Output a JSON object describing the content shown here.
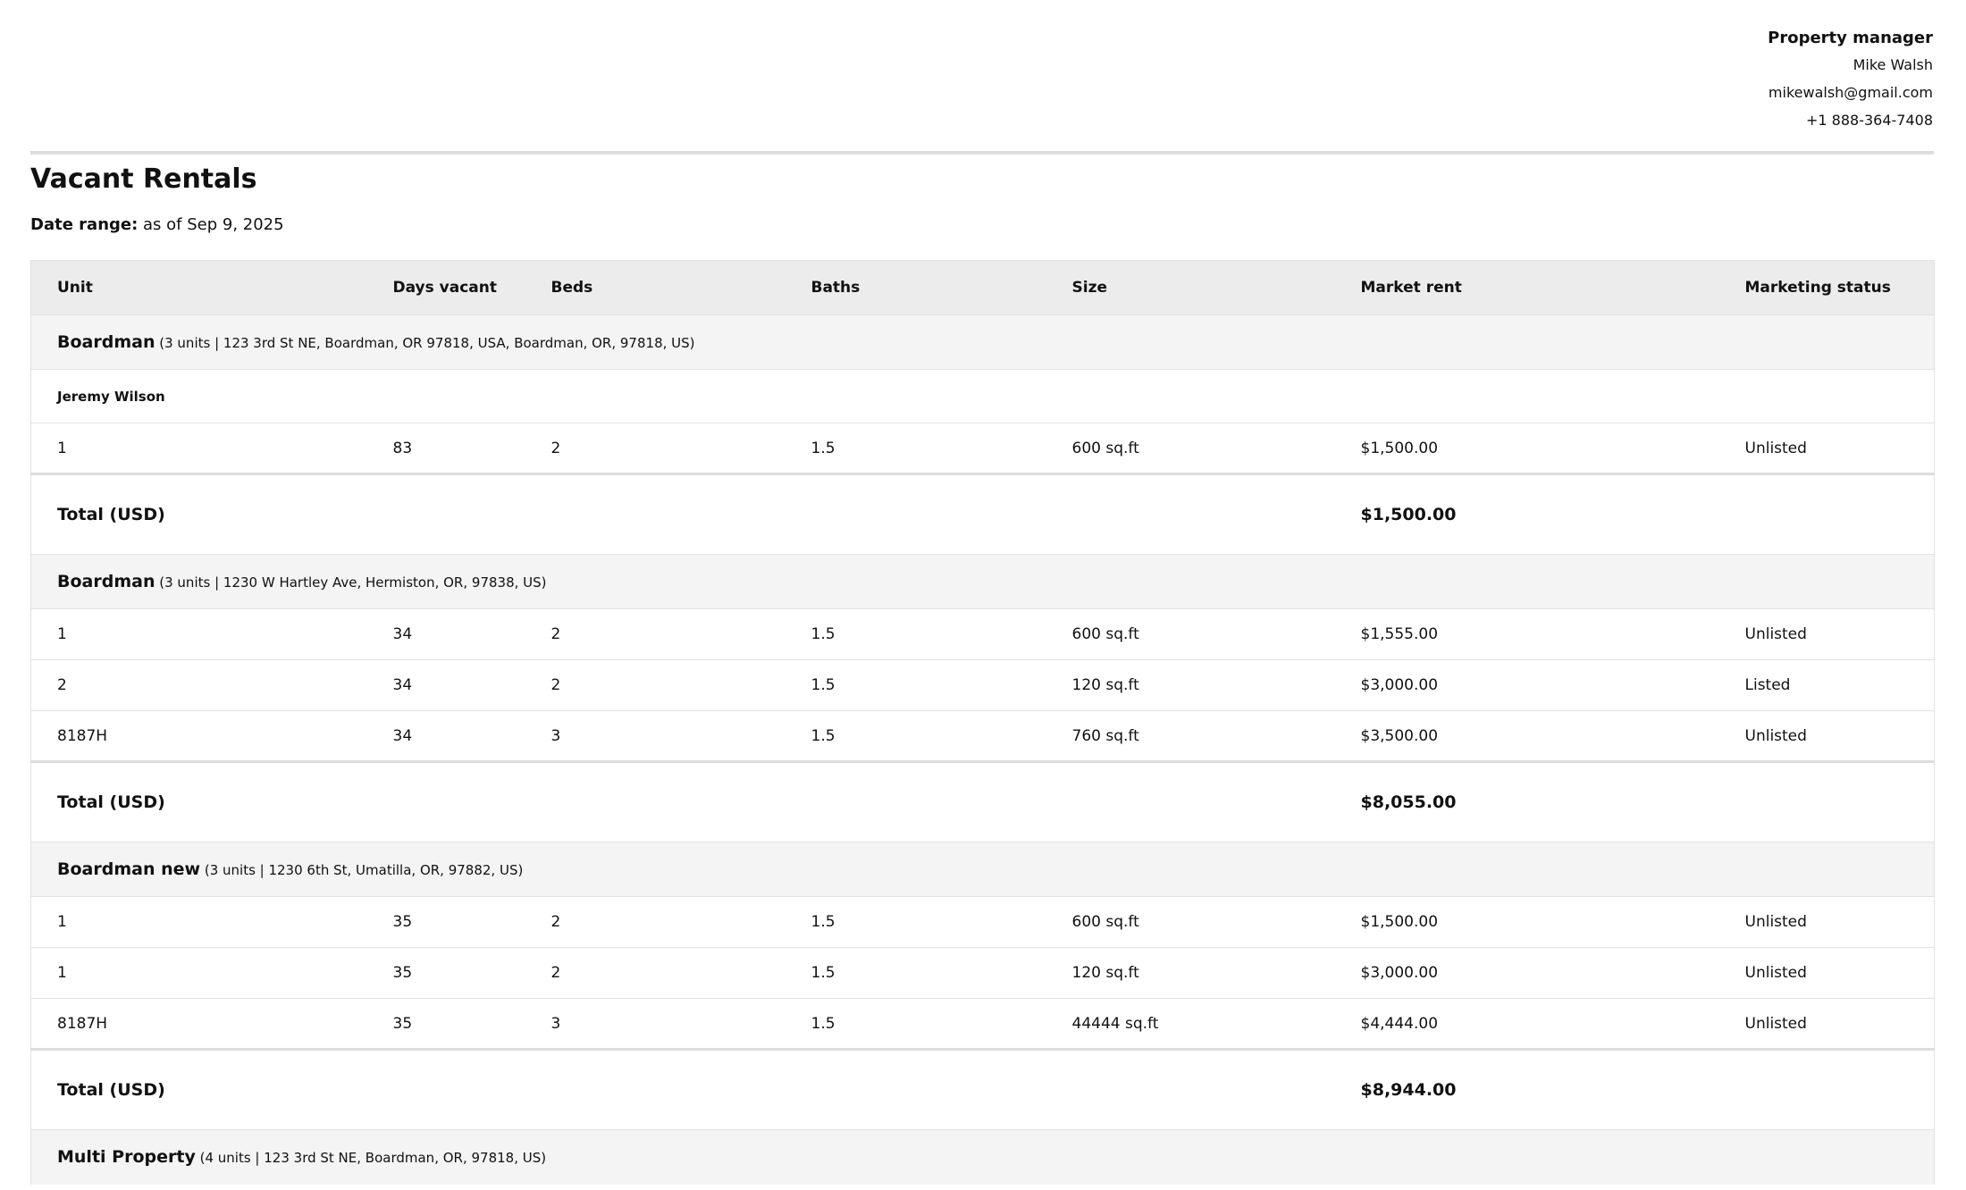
{
  "manager": {
    "title": "Property manager",
    "name": "Mike Walsh",
    "email": "mikewalsh@gmail.com",
    "phone": "+1 888-364-7408"
  },
  "report": {
    "title": "Vacant Rentals",
    "date_range_label": "Date range:",
    "date_range_value": "as of Sep 9, 2025"
  },
  "table": {
    "columns": [
      "Unit",
      "Days vacant",
      "Beds",
      "Baths",
      "Size",
      "Market rent",
      "Marketing status"
    ],
    "total_label": "Total (USD)",
    "groups": [
      {
        "name": "Boardman",
        "details": "(3 units | 123 3rd St NE, Boardman, OR 97818, USA, Boardman, OR, 97818, US)",
        "tenant": "Jeremy Wilson",
        "rows": [
          [
            "1",
            "83",
            "2",
            "1.5",
            "600 sq.ft",
            "$1,500.00",
            "Unlisted"
          ]
        ],
        "total": "$1,500.00"
      },
      {
        "name": "Boardman",
        "details": "(3 units | 1230 W Hartley Ave, Hermiston, OR, 97838, US)",
        "rows": [
          [
            "1",
            "34",
            "2",
            "1.5",
            "600 sq.ft",
            "$1,555.00",
            "Unlisted"
          ],
          [
            "2",
            "34",
            "2",
            "1.5",
            "120 sq.ft",
            "$3,000.00",
            "Listed"
          ],
          [
            "8187H",
            "34",
            "3",
            "1.5",
            "760 sq.ft",
            "$3,500.00",
            "Unlisted"
          ]
        ],
        "total": "$8,055.00"
      },
      {
        "name": "Boardman new",
        "details": "(3 units | 1230 6th St, Umatilla, OR, 97882, US)",
        "rows": [
          [
            "1",
            "35",
            "2",
            "1.5",
            "600 sq.ft",
            "$1,500.00",
            "Unlisted"
          ],
          [
            "1",
            "35",
            "2",
            "1.5",
            "120 sq.ft",
            "$3,000.00",
            "Unlisted"
          ],
          [
            "8187H",
            "35",
            "3",
            "1.5",
            "44444 sq.ft",
            "$4,444.00",
            "Unlisted"
          ]
        ],
        "total": "$8,944.00"
      },
      {
        "name": "Multi Property",
        "details": "(4 units | 123 3rd St NE, Boardman, OR, 97818, US)",
        "rows": []
      }
    ]
  }
}
